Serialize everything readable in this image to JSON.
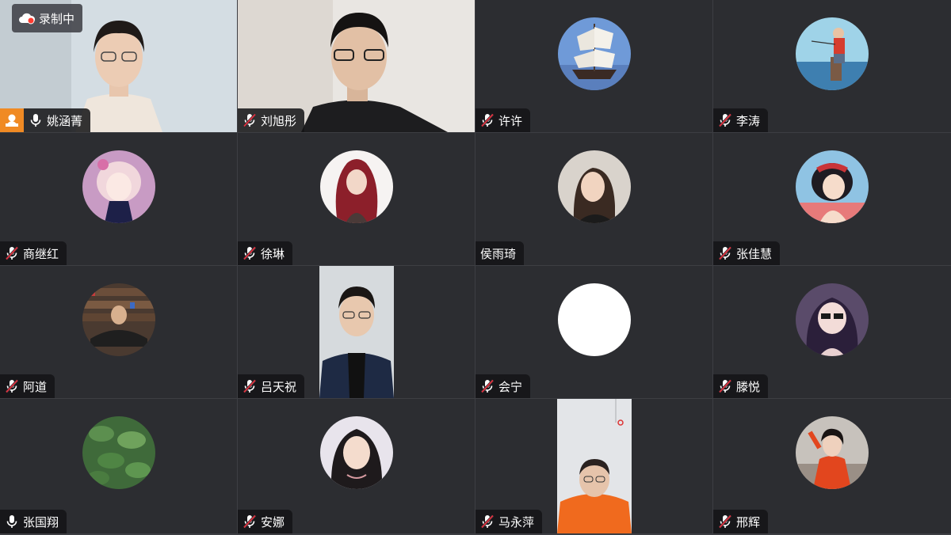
{
  "recording": {
    "label": "录制中",
    "dot_color": "#ff3b30"
  },
  "colors": {
    "host_badge": "#f08a24",
    "muted_slash": "#e0313f",
    "tile_bg": "#2c2d31"
  },
  "participants": [
    {
      "name": "姚涵菁",
      "mic": "on",
      "host": true,
      "view": "camera"
    },
    {
      "name": "刘旭彤",
      "mic": "muted",
      "view": "camera"
    },
    {
      "name": "许许",
      "mic": "muted",
      "view": "avatar"
    },
    {
      "name": "李涛",
      "mic": "muted",
      "view": "avatar"
    },
    {
      "name": "商继红",
      "mic": "muted",
      "view": "avatar"
    },
    {
      "name": "徐琳",
      "mic": "muted",
      "view": "avatar"
    },
    {
      "name": "侯雨琦",
      "mic": "none",
      "view": "avatar"
    },
    {
      "name": "张佳慧",
      "mic": "muted",
      "view": "avatar"
    },
    {
      "name": "阿道",
      "mic": "muted",
      "view": "avatar"
    },
    {
      "name": "吕天祝",
      "mic": "muted",
      "view": "camera-portrait"
    },
    {
      "name": "会宁",
      "mic": "muted",
      "view": "avatar"
    },
    {
      "name": "滕悦",
      "mic": "muted",
      "view": "avatar"
    },
    {
      "name": "张国翔",
      "mic": "on",
      "view": "avatar"
    },
    {
      "name": "安娜",
      "mic": "muted",
      "view": "avatar"
    },
    {
      "name": "马永萍",
      "mic": "muted",
      "view": "camera-portrait"
    },
    {
      "name": "邢辉",
      "mic": "muted",
      "view": "avatar"
    }
  ]
}
